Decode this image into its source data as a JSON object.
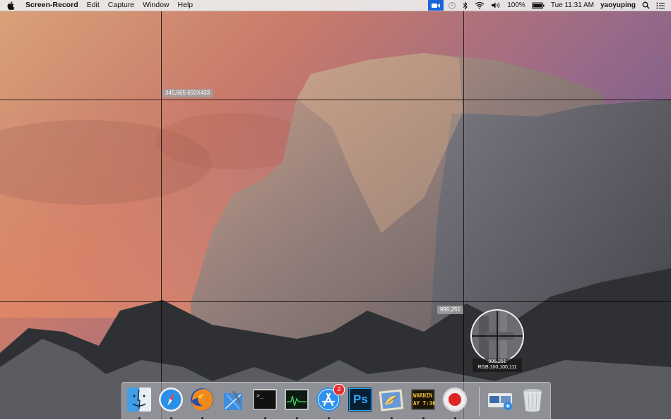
{
  "menubar": {
    "app_name": "Screen-Record",
    "menus": [
      "Edit",
      "Capture",
      "Window",
      "Help"
    ],
    "battery": "100%",
    "clock": "Tue 11:31 AM",
    "user": "yaoyuping"
  },
  "capture": {
    "selection_label": "345,665  650X433",
    "cursor_label": "995,251",
    "magnifier_coords": "995,251",
    "magnifier_rgb": "RGB:100,100,111"
  },
  "dock": {
    "items": [
      {
        "name": "Finder",
        "icon": "finder-icon",
        "running": true
      },
      {
        "name": "Safari",
        "icon": "safari-icon",
        "running": true
      },
      {
        "name": "Firefox",
        "icon": "firefox-icon",
        "running": true
      },
      {
        "name": "Xcode",
        "icon": "xcode-icon",
        "running": false
      },
      {
        "name": "Terminal",
        "icon": "terminal-icon",
        "running": true
      },
      {
        "name": "Activity Monitor",
        "icon": "activity-monitor-icon",
        "running": true
      },
      {
        "name": "App Store",
        "icon": "app-store-icon",
        "running": true,
        "badge": "2"
      },
      {
        "name": "Photoshop",
        "icon": "photoshop-icon",
        "running": false
      },
      {
        "name": "Mail",
        "icon": "mail-icon",
        "running": true
      },
      {
        "name": "Console",
        "icon": "console-icon",
        "running": true
      },
      {
        "name": "Screen-Record",
        "icon": "record-icon",
        "running": true
      },
      {
        "name": "Preview",
        "icon": "preview-icon",
        "running": false
      },
      {
        "name": "Trash",
        "icon": "trash-icon",
        "running": false
      }
    ],
    "labels": {
      "terminal_prompt": ">_",
      "photoshop_text": "Ps",
      "console_text_1": "WARNIN",
      "console_text_2": "AY 7:36"
    }
  },
  "colors": {
    "accent": "#1a66d9",
    "record_red": "#e02424"
  }
}
